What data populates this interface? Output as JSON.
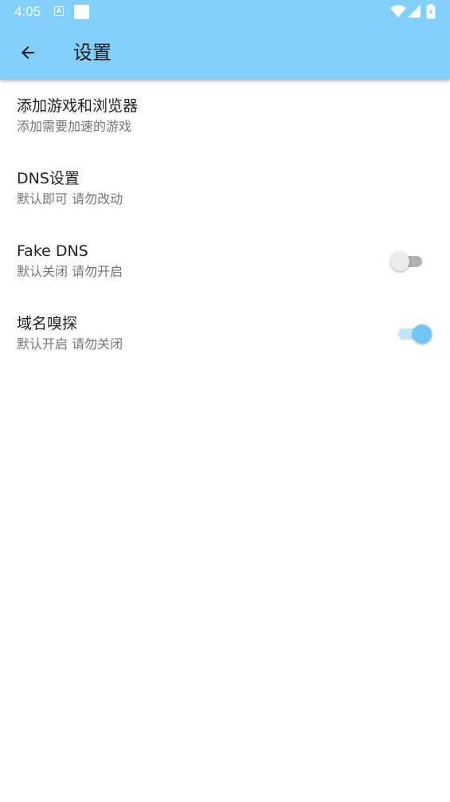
{
  "status_bar": {
    "time": "4:05",
    "notification_letter": "A"
  },
  "header": {
    "title": "设置"
  },
  "settings": [
    {
      "title": "添加游戏和浏览器",
      "subtitle": "添加需要加速的游戏"
    },
    {
      "title": "DNS设置",
      "subtitle": "默认即可 请勿改动"
    },
    {
      "title": "Fake DNS",
      "subtitle": "默认关闭 请勿开启",
      "switch_on": false
    },
    {
      "title": "域名嗅探",
      "subtitle": "默认开启 请勿关闭",
      "switch_on": true
    }
  ],
  "colors": {
    "app_bar": "#81cffa",
    "accent": "#6ec6f9"
  },
  "icons": {
    "back": "arrow-left-icon",
    "wifi": "wifi-icon",
    "signal": "cell-signal-icon",
    "battery": "battery-charging-icon"
  }
}
